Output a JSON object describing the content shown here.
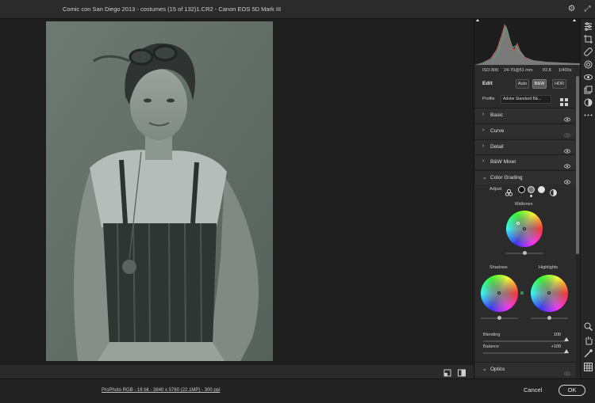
{
  "window": {
    "title": "Comic con San Diego 2013 - costumes (15 of 132)1.CR2  -  Canon EOS 5D Mark III"
  },
  "histogram": {
    "exif": {
      "iso": "ISO 800",
      "lens": "24-70@51 mm",
      "aperture": "f/2.8",
      "shutter": "1/400s"
    }
  },
  "edit": {
    "title": "Edit",
    "buttons": [
      "Auto",
      "B&W",
      "HDR"
    ],
    "active_button": "B&W",
    "profile_label": "Profile",
    "profile_value": "Adobe Standard B&..."
  },
  "sections": [
    {
      "name": "Basic",
      "expanded": false,
      "visible": true
    },
    {
      "name": "Curve",
      "expanded": false,
      "visible": false
    },
    {
      "name": "Detail",
      "expanded": false,
      "visible": true
    },
    {
      "name": "B&W Mixer",
      "expanded": false,
      "visible": true
    },
    {
      "name": "Color Grading",
      "expanded": true,
      "visible": true
    },
    {
      "name": "Optics",
      "expanded": true,
      "visible": false
    }
  ],
  "color_grading": {
    "adjust_label": "Adjust",
    "wheels": {
      "midtones": "Midtones",
      "shadows": "Shadows",
      "highlights": "Highlights"
    },
    "sliders": [
      {
        "label": "Blending",
        "value": "100",
        "fraction": 1.0
      },
      {
        "label": "Balance",
        "value": "+100",
        "fraction": 1.0
      }
    ]
  },
  "footer": {
    "info": "ProPhoto RGB - 16 bit - 3840 x 5760 (22.1MP) - 300 ppi",
    "cancel": "Cancel",
    "ok": "OK"
  },
  "colors": {
    "accent": "#ffffff",
    "panel_bg": "#2b2b2b",
    "photo_tint": "#5e6a65"
  },
  "tools": [
    "edit-icon",
    "crop-icon",
    "healing-icon",
    "masking-icon",
    "redeye-icon",
    "presets-icon",
    "snapshots-icon",
    "more-icon",
    "zoom-icon",
    "hand-icon",
    "color-sampler-icon",
    "grid-icon"
  ]
}
